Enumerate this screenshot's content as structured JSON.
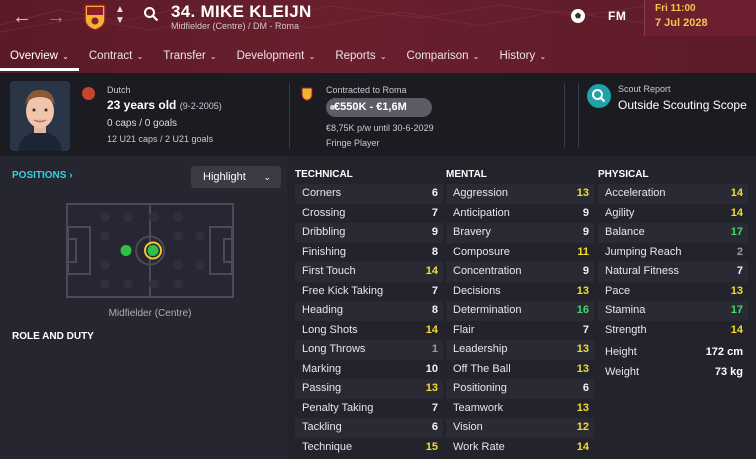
{
  "header": {
    "player_name": "34. MIKE KLEIJN",
    "subtitle": "Midfielder (Centre) / DM - Roma",
    "logo": "FM",
    "date_day": "Fri 11:00",
    "date": "7 Jul 2028",
    "back_icon": "arrow-left-icon",
    "forward_icon": "arrow-right-icon",
    "search_icon": "search-icon"
  },
  "tabs": [
    {
      "label": "Overview",
      "active": true
    },
    {
      "label": "Contract"
    },
    {
      "label": "Transfer"
    },
    {
      "label": "Development"
    },
    {
      "label": "Reports"
    },
    {
      "label": "Comparison"
    },
    {
      "label": "History"
    }
  ],
  "profile": {
    "nationality": "Dutch",
    "age": "23 years old",
    "dob": "(9-2-2005)",
    "caps": "0 caps / 0 goals",
    "u21": "12 U21 caps / 2 U21 goals"
  },
  "contract": {
    "label": "Contracted to Roma",
    "value": "€550K - €1,6M",
    "wage": "€8,75K p/w until 30-6-2029",
    "status": "Fringe Player"
  },
  "scout": {
    "label": "Scout Report",
    "value": "Outside Scouting Scope"
  },
  "positions": {
    "label": "POSITIONS",
    "dropdown": "Highlight",
    "position_label": "Midfielder (Centre)",
    "role_label": "ROLE AND DUTY"
  },
  "colors": {
    "header": "#6a1f2d",
    "accent": "#32d4e0",
    "yellow": "#f3dd2c",
    "green": "#48d86a"
  },
  "technical": {
    "title": "TECHNICAL",
    "attributes": [
      {
        "name": "Corners",
        "value": "6"
      },
      {
        "name": "Crossing",
        "value": "7"
      },
      {
        "name": "Dribbling",
        "value": "9"
      },
      {
        "name": "Finishing",
        "value": "8"
      },
      {
        "name": "First Touch",
        "value": "14"
      },
      {
        "name": "Free Kick Taking",
        "value": "7"
      },
      {
        "name": "Heading",
        "value": "8"
      },
      {
        "name": "Long Shots",
        "value": "14"
      },
      {
        "name": "Long Throws",
        "value": "1"
      },
      {
        "name": "Marking",
        "value": "10"
      },
      {
        "name": "Passing",
        "value": "13"
      },
      {
        "name": "Penalty Taking",
        "value": "7"
      },
      {
        "name": "Tackling",
        "value": "6"
      },
      {
        "name": "Technique",
        "value": "15"
      }
    ]
  },
  "mental": {
    "title": "MENTAL",
    "attributes": [
      {
        "name": "Aggression",
        "value": "13"
      },
      {
        "name": "Anticipation",
        "value": "9"
      },
      {
        "name": "Bravery",
        "value": "9"
      },
      {
        "name": "Composure",
        "value": "11"
      },
      {
        "name": "Concentration",
        "value": "9"
      },
      {
        "name": "Decisions",
        "value": "13"
      },
      {
        "name": "Determination",
        "value": "16"
      },
      {
        "name": "Flair",
        "value": "7"
      },
      {
        "name": "Leadership",
        "value": "13"
      },
      {
        "name": "Off The Ball",
        "value": "13"
      },
      {
        "name": "Positioning",
        "value": "6"
      },
      {
        "name": "Teamwork",
        "value": "13"
      },
      {
        "name": "Vision",
        "value": "12"
      },
      {
        "name": "Work Rate",
        "value": "14"
      }
    ]
  },
  "physical": {
    "title": "PHYSICAL",
    "attributes": [
      {
        "name": "Acceleration",
        "value": "14"
      },
      {
        "name": "Agility",
        "value": "14"
      },
      {
        "name": "Balance",
        "value": "17"
      },
      {
        "name": "Jumping Reach",
        "value": "2"
      },
      {
        "name": "Natural Fitness",
        "value": "7"
      },
      {
        "name": "Pace",
        "value": "13"
      },
      {
        "name": "Stamina",
        "value": "17"
      },
      {
        "name": "Strength",
        "value": "14"
      }
    ],
    "height_label": "Height",
    "height": "172 cm",
    "weight_label": "Weight",
    "weight": "73 kg"
  }
}
